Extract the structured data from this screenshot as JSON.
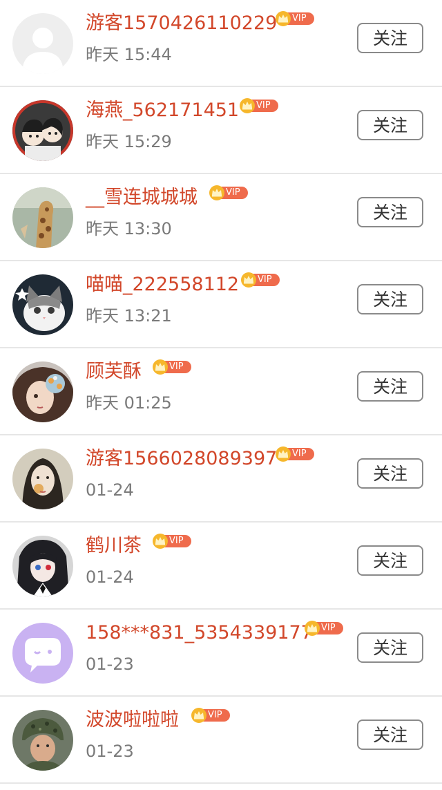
{
  "follow_label": "关注",
  "vip_badge": {
    "label": "VIP",
    "icon": "crown-icon",
    "colors": {
      "badge_bg": "#ef6b4c",
      "crown": "#f6b72c",
      "text": "#ffffff"
    }
  },
  "colors": {
    "name": "#d2472a",
    "time": "#7a7a7a",
    "divider": "#e6e6e6",
    "button_border": "#8a8a8a"
  },
  "users": [
    {
      "name": "游客1570426110229",
      "time": "昨天 15:44",
      "vip": true,
      "avatar": "default-avatar"
    },
    {
      "name": "海燕_562171451",
      "time": "昨天 15:29",
      "vip": true,
      "avatar": "illustrated-couple"
    },
    {
      "name": "__雪连城城城",
      "time": "昨天 13:30",
      "vip": true,
      "avatar": "giraffe"
    },
    {
      "name": "喵喵_222558112",
      "time": "昨天 13:21",
      "vip": true,
      "avatar": "cat"
    },
    {
      "name": "顾芙酥",
      "time": "昨天 01:25",
      "vip": true,
      "avatar": "anime-girl-flowers"
    },
    {
      "name": "游客1566028089397",
      "time": "01-24",
      "vip": true,
      "avatar": "girl-photo"
    },
    {
      "name": "鹤川茶",
      "time": "01-24",
      "vip": true,
      "avatar": "anime-dark-hair"
    },
    {
      "name": "158***831_5354339177",
      "time": "01-23",
      "vip": true,
      "avatar": "chat-bubble"
    },
    {
      "name": "波波啦啦啦",
      "time": "01-23",
      "vip": true,
      "avatar": "soldier-photo"
    }
  ]
}
